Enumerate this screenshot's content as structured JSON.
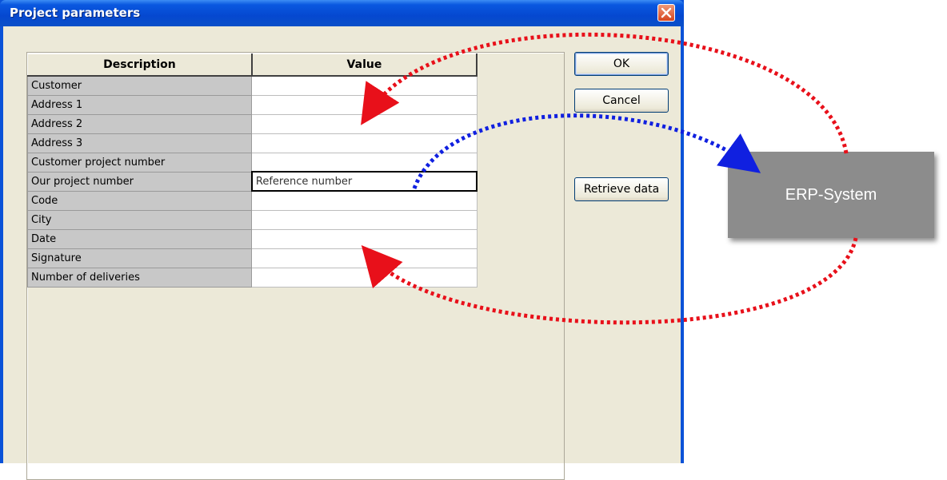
{
  "dialog": {
    "title": "Project parameters",
    "columns": {
      "description": "Description",
      "value": "Value"
    },
    "rows": [
      {
        "description": "Customer",
        "value": ""
      },
      {
        "description": "Address 1",
        "value": ""
      },
      {
        "description": "Address 2",
        "value": ""
      },
      {
        "description": "Address 3",
        "value": ""
      },
      {
        "description": "Customer project number",
        "value": ""
      },
      {
        "description": "Our project number",
        "value": "Reference number"
      },
      {
        "description": "Code",
        "value": ""
      },
      {
        "description": "City",
        "value": ""
      },
      {
        "description": "Date",
        "value": ""
      },
      {
        "description": "Signature",
        "value": ""
      },
      {
        "description": "Number of deliveries",
        "value": ""
      }
    ],
    "buttons": {
      "ok": "OK",
      "cancel": "Cancel",
      "retrieve": "Retrieve data"
    }
  },
  "erp": {
    "label": "ERP-System"
  },
  "colors": {
    "title_bar": "#0548d0",
    "arrow_red": "#e8101a",
    "arrow_blue": "#1020e0",
    "erp_box": "#8c8c8c"
  },
  "icons": {
    "close": "close-icon"
  }
}
